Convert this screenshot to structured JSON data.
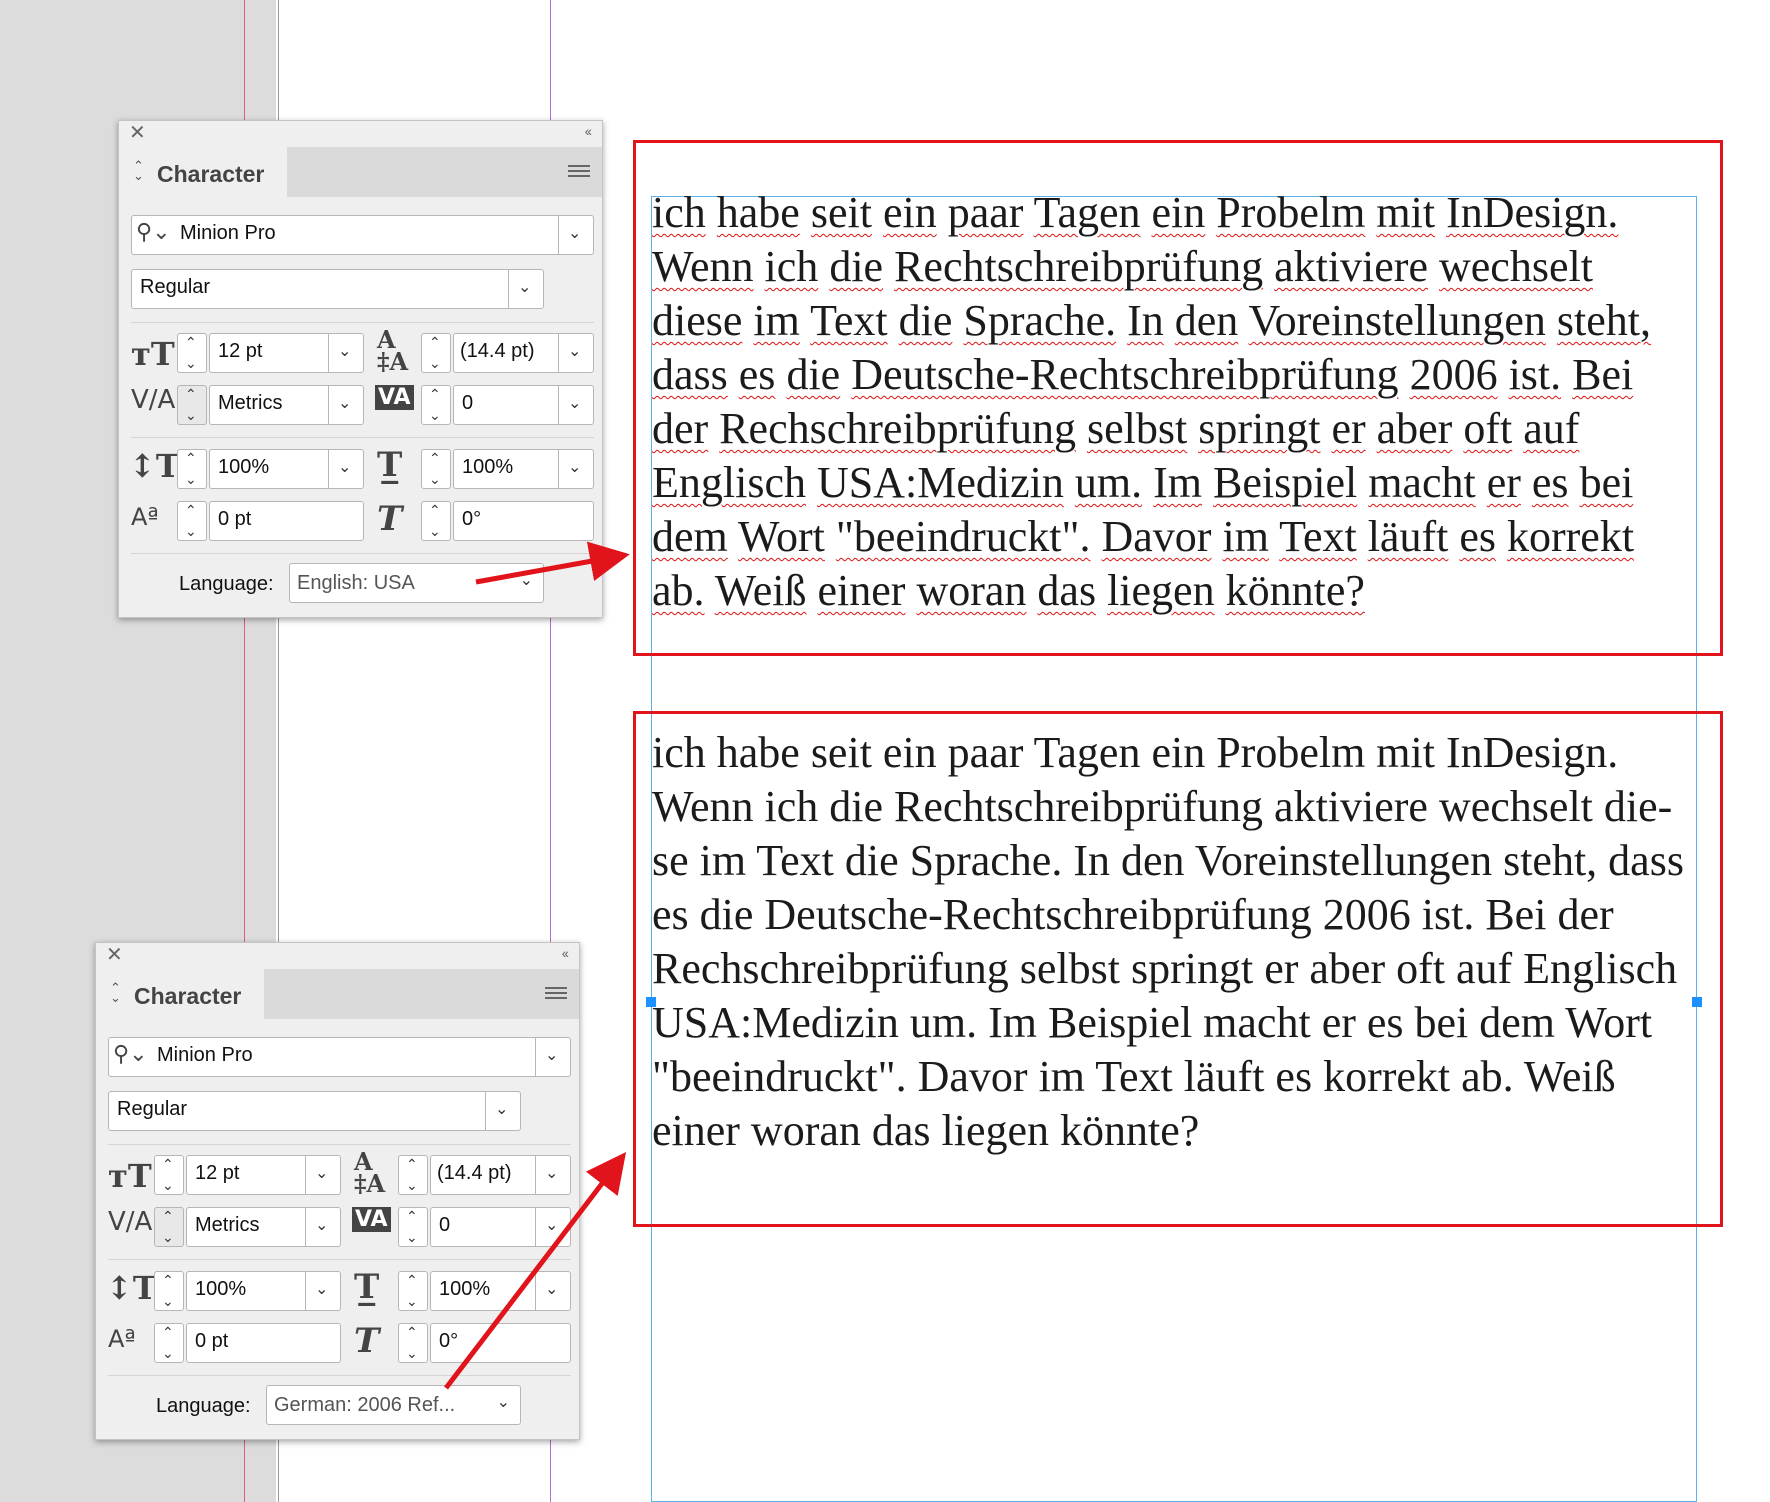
{
  "panels": {
    "top": {
      "tab": "Character",
      "font_family": "Minion Pro",
      "font_style": "Regular",
      "size": "12 pt",
      "leading": "(14.4 pt)",
      "kerning": "Metrics",
      "tracking": "0",
      "vertical_scale": "100%",
      "horizontal_scale": "100%",
      "baseline_shift": "0 pt",
      "skew": "0°",
      "language_label": "Language:",
      "language": "English: USA"
    },
    "bottom": {
      "tab": "Character",
      "font_family": "Minion Pro",
      "font_style": "Regular",
      "size": "12 pt",
      "leading": "(14.4 pt)",
      "kerning": "Metrics",
      "tracking": "0",
      "vertical_scale": "100%",
      "horizontal_scale": "100%",
      "baseline_shift": "0 pt",
      "skew": "0°",
      "language_label": "Language:",
      "language": "German: 2006 Ref..."
    }
  },
  "text_top_lines": [
    "ich habe seit ein paar Tagen ein Probelm mit InDesign.",
    "Wenn ich die Rechtschreibprüfung aktiviere wechselt",
    "diese im Text die Sprache. In den Voreinstellungen steht,",
    "dass es die Deutsche-Rechtschreibprüfung 2006 ist. Bei",
    "der Rechschreibprüfung selbst springt er aber oft auf",
    "Englisch USA:Medizin um. Im Beispiel macht er es bei",
    "dem Wort \"beeindruckt\". Davor im Text läuft es korrekt",
    "ab. Weiß einer woran das liegen könnte?"
  ],
  "text_bottom_lines": [
    "ich habe seit ein paar Tagen ein Probelm mit InDesign.",
    "Wenn ich die Rechtschreibprüfung aktiviere wechselt die-",
    "se im Text die Sprache. In den Voreinstellungen steht, dass",
    "es die Deutsche-Rechtschreibprüfung 2006 ist. Bei der",
    "Rechschreibprüfung selbst springt er aber oft auf Englisch",
    "USA:Medizin um. Im Beispiel macht er es bei dem Wort",
    "\"beeindruckt\". Davor im Text läuft es korrekt ab. Weiß",
    "einer woran das liegen könnte?"
  ],
  "icons": {
    "close": "✕",
    "collapse": "‹‹",
    "search": "search-icon",
    "menu": "panel-menu-icon"
  },
  "colors": {
    "annotation_red": "#e0141a",
    "frame_blue": "#5ab4e6",
    "spell_underline": "#d11"
  }
}
